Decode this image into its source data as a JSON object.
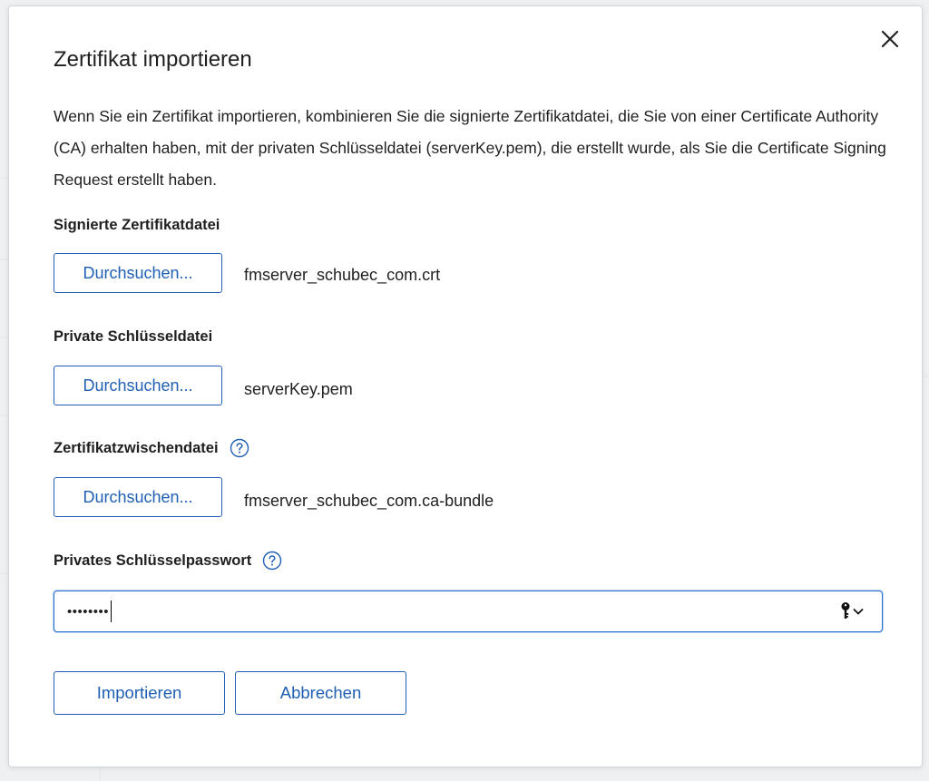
{
  "dialog": {
    "title": "Zertifikat importieren",
    "description": "Wenn Sie ein Zertifikat importieren, kombinieren Sie die signierte Zertifikatdatei, die Sie von einer Certificate Authority (CA) erhalten haben, mit der privaten Schlüsseldatei (serverKey.pem), die erstellt wurde, als Sie die Certificate Signing Request erstellt haben.",
    "close_icon": "close-icon"
  },
  "signed_certificate": {
    "label": "Signierte Zertifikatdatei",
    "browse_label": "Durchsuchen...",
    "file_name": "fmserver_schubec_com.crt"
  },
  "private_key": {
    "label": "Private Schlüsseldatei",
    "browse_label": "Durchsuchen...",
    "file_name": "serverKey.pem"
  },
  "intermediate_certificate": {
    "label": "Zertifikatzwischendatei",
    "help_icon": "help-circle-icon",
    "browse_label": "Durchsuchen...",
    "file_name": "fmserver_schubec_com.ca-bundle"
  },
  "private_key_password": {
    "label": "Privates Schlüsselpasswort",
    "help_icon": "help-circle-icon",
    "masked_value": "••••••••",
    "key_icon": "key-icon",
    "chevron_icon": "chevron-down-icon"
  },
  "actions": {
    "import_label": "Importieren",
    "cancel_label": "Abbrechen"
  },
  "colors": {
    "accent": "#1f5fb4",
    "focus_border": "#2a6fd0",
    "text": "#1f1f1f",
    "backdrop": "#eef0f2"
  }
}
